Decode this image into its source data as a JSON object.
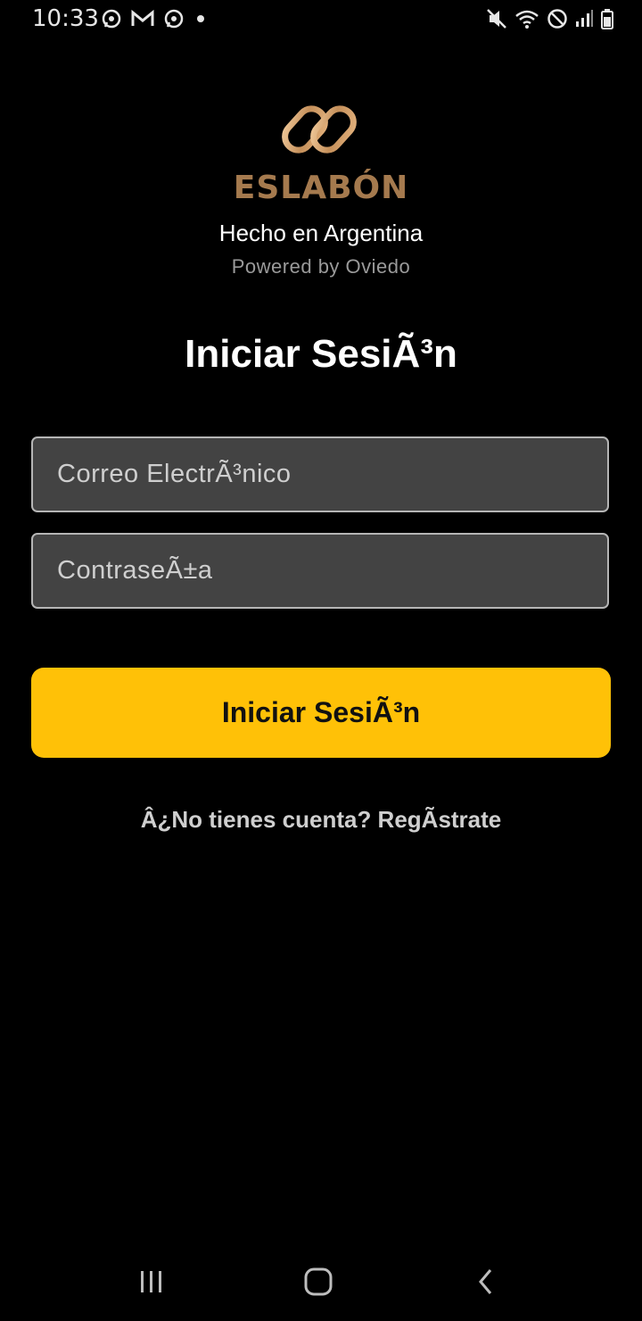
{
  "status_bar": {
    "time": "10:33",
    "left_icons": [
      "whatsapp-icon",
      "gmail-icon",
      "whatsapp-icon",
      "dot-icon"
    ],
    "right_icons": [
      "mute-icon",
      "wifi-icon",
      "do-not-disturb-icon",
      "signal-icon",
      "battery-icon"
    ]
  },
  "brand": {
    "name": "ESLABÓN",
    "tagline": "Hecho en Argentina",
    "powered_by": "Powered by Oviedo",
    "logo_icon": "chain-link-logo-icon",
    "color": "#a57a4e"
  },
  "login": {
    "title": "Iniciar SesiÃ³n",
    "email_placeholder": "Correo ElectrÃ³nico",
    "email_value": "",
    "password_placeholder": "ContraseÃ±a",
    "password_value": "",
    "submit_label": "Iniciar SesiÃ³n",
    "register_link": "Â¿No tienes cuenta? RegÃstrate",
    "accent_color": "#ffc107"
  },
  "nav_bar": {
    "buttons": [
      "recents-icon",
      "home-icon",
      "back-icon"
    ]
  }
}
